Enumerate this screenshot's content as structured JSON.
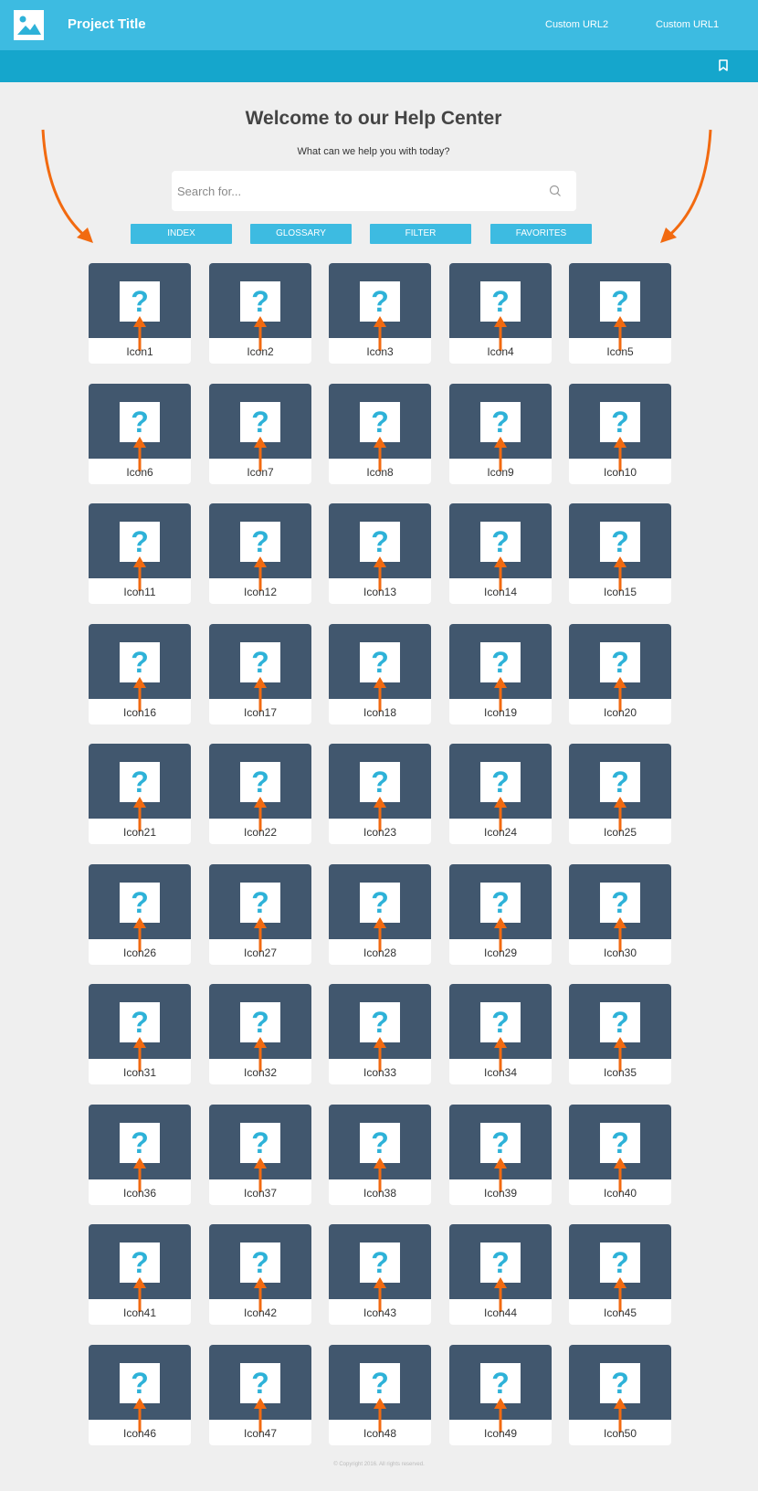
{
  "header": {
    "title": "Project Title",
    "links": [
      "Custom URL2",
      "Custom URL1"
    ]
  },
  "hero": {
    "title": "Welcome to our Help Center",
    "subtitle": "What can we help you with today?",
    "search_placeholder": "Search for..."
  },
  "buttons": [
    "INDEX",
    "GLOSSARY",
    "FILTER",
    "FAVORITES"
  ],
  "icons": [
    "Icon1",
    "Icon2",
    "Icon3",
    "Icon4",
    "Icon5",
    "Icon6",
    "Icon7",
    "Icon8",
    "Icon9",
    "Icon10",
    "Icon11",
    "Icon12",
    "Icon13",
    "Icon14",
    "Icon15",
    "Icon16",
    "Icon17",
    "Icon18",
    "Icon19",
    "Icon20",
    "Icon21",
    "Icon22",
    "Icon23",
    "Icon24",
    "Icon25",
    "Icon26",
    "Icon27",
    "Icon28",
    "Icon29",
    "Icon30",
    "Icon31",
    "Icon32",
    "Icon33",
    "Icon34",
    "Icon35",
    "Icon36",
    "Icon37",
    "Icon38",
    "Icon39",
    "Icon40",
    "Icon41",
    "Icon42",
    "Icon43",
    "Icon44",
    "Icon45",
    "Icon46",
    "Icon47",
    "Icon48",
    "Icon49",
    "Icon50"
  ],
  "card_glyph": "?",
  "footer": "© Copyright 2016. All rights reserved.",
  "colors": {
    "topbar": "#3dbbe1",
    "subbar": "#15a6cc",
    "card_top": "#41576e",
    "accent": "#2eb2d8",
    "annotation_arrow": "#f26a10"
  }
}
